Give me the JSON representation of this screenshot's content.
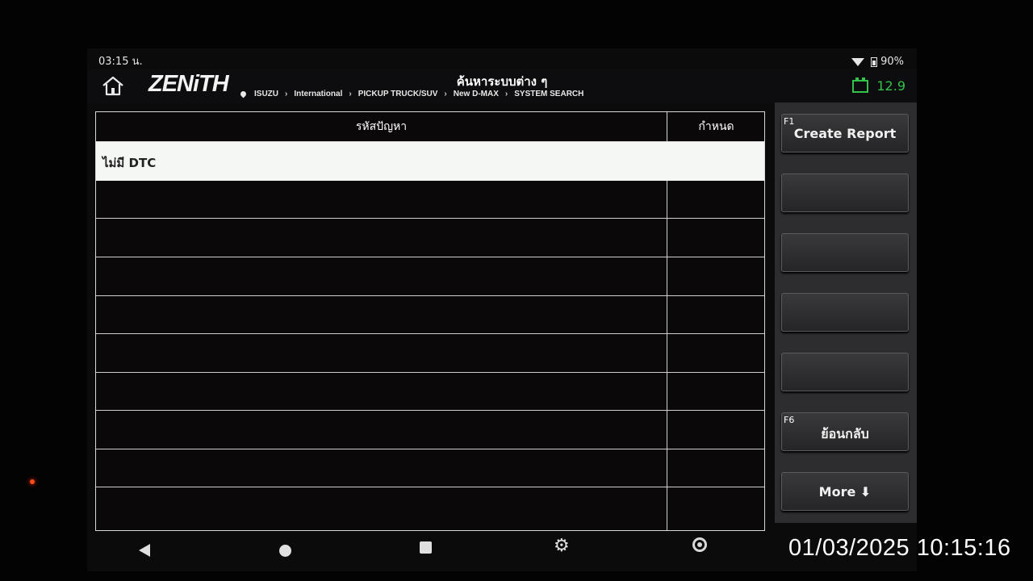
{
  "status_bar": {
    "time": "03:15 น.",
    "battery_percent": "90%",
    "icons": [
      "wifi-icon",
      "battery-icon"
    ]
  },
  "header": {
    "logo": "ZENiTH",
    "title": "ค้นหาระบบต่าง ๆ",
    "breadcrumb": [
      "ISUZU",
      "International",
      "PICKUP TRUCK/SUV",
      "New D-MAX",
      "SYSTEM SEARCH"
    ],
    "voltage": "12.9",
    "accent_color": "#33c24a"
  },
  "table": {
    "columns": [
      "รหัสปัญหา",
      "กำหนด"
    ],
    "rows": [
      {
        "code": "ไม่มี DTC",
        "definition": "",
        "selected": true
      },
      {
        "code": "",
        "definition": ""
      },
      {
        "code": "",
        "definition": ""
      },
      {
        "code": "",
        "definition": ""
      },
      {
        "code": "",
        "definition": ""
      },
      {
        "code": "",
        "definition": ""
      },
      {
        "code": "",
        "definition": ""
      },
      {
        "code": "",
        "definition": ""
      },
      {
        "code": "",
        "definition": ""
      },
      {
        "code": "",
        "definition": ""
      }
    ]
  },
  "side_panel": {
    "buttons": [
      {
        "key": "F1",
        "label": "Create Report"
      },
      {
        "key": "",
        "label": ""
      },
      {
        "key": "",
        "label": ""
      },
      {
        "key": "",
        "label": ""
      },
      {
        "key": "",
        "label": ""
      },
      {
        "key": "F6",
        "label": "ย้อนกลับ"
      },
      {
        "key": "",
        "label": "More ⬇"
      }
    ]
  },
  "navbar": {
    "icons": [
      "back-icon",
      "home-icon",
      "recent-apps-icon",
      "settings-icon",
      "chrome-icon"
    ]
  },
  "overlay": {
    "timestamp": "01/03/2025 10:15:16"
  }
}
